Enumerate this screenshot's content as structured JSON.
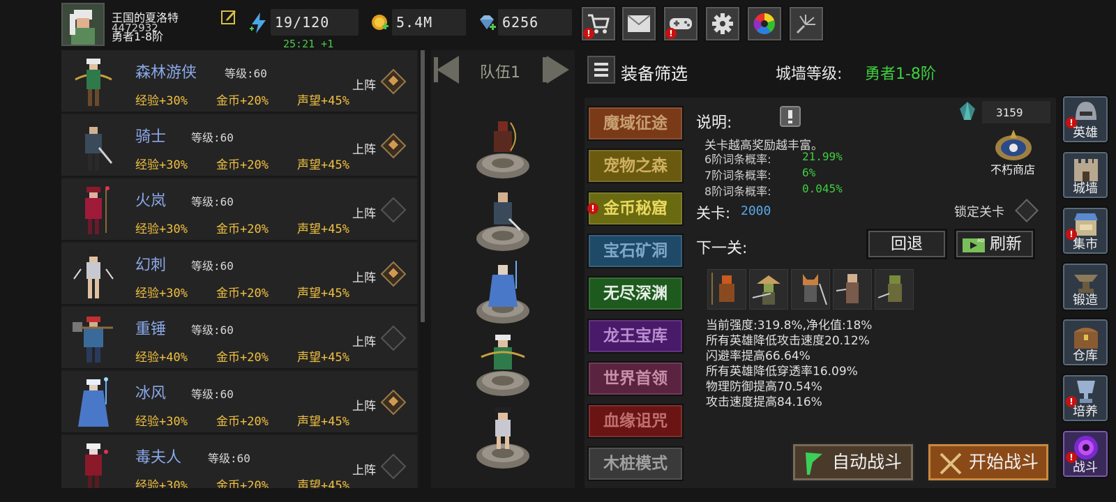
{
  "player": {
    "name": "王国的夏洛特",
    "id": "4472932",
    "rank": "勇者1-8阶"
  },
  "resources": {
    "energy": "19/120",
    "energy_timer": "25:21 +1",
    "gold": "5.4M",
    "gems": "6256"
  },
  "top_buttons": [
    "shop-cart-icon",
    "mail-icon",
    "gamepad-icon",
    "settings-gear-icon",
    "color-wheel-icon",
    "fireworks-icon"
  ],
  "heroes": [
    {
      "name": "森林游侠",
      "level": "等级:60",
      "exp": "经验+30%",
      "gold": "金币+20%",
      "fame": "声望+45%",
      "deploy": "上阵",
      "deployed": true
    },
    {
      "name": "骑士",
      "level": "等级:60",
      "exp": "经验+30%",
      "gold": "金币+20%",
      "fame": "声望+45%",
      "deploy": "上阵",
      "deployed": true
    },
    {
      "name": "火岚",
      "level": "等级:60",
      "exp": "经验+30%",
      "gold": "金币+20%",
      "fame": "声望+45%",
      "deploy": "上阵",
      "deployed": false
    },
    {
      "name": "幻刺",
      "level": "等级:60",
      "exp": "经验+30%",
      "gold": "金币+20%",
      "fame": "声望+45%",
      "deploy": "上阵",
      "deployed": true
    },
    {
      "name": "重锤",
      "level": "等级:60",
      "exp": "经验+40%",
      "gold": "金币+20%",
      "fame": "声望+45%",
      "deploy": "上阵",
      "deployed": false
    },
    {
      "name": "冰风",
      "level": "等级:60",
      "exp": "经验+30%",
      "gold": "金币+20%",
      "fame": "声望+45%",
      "deploy": "上阵",
      "deployed": true
    },
    {
      "name": "毒夫人",
      "level": "等级:60",
      "exp": "经验+30%",
      "gold": "金币+20%",
      "fame": "声望+45%",
      "deploy": "上阵",
      "deployed": false
    }
  ],
  "team": {
    "label": "队伍1"
  },
  "filter": {
    "label": "装备筛选"
  },
  "wall": {
    "label": "城墙等级:",
    "value": "勇者1-8阶"
  },
  "modes": [
    {
      "label": "魔域征途",
      "color": "#7a3a18",
      "text": "#c8a070"
    },
    {
      "label": "宠物之森",
      "color": "#6a5a10",
      "text": "#d0b060"
    },
    {
      "label": "金币秘窟",
      "color": "#6a6a10",
      "text": "#e8d860"
    },
    {
      "label": "宝石矿洞",
      "color": "#1e4a68",
      "text": "#80a8c8"
    },
    {
      "label": "无尽深渊",
      "color": "#1e5a1e",
      "text": "#e8f0e8"
    },
    {
      "label": "龙王宝库",
      "color": "#4a1a6a",
      "text": "#b890d0"
    },
    {
      "label": "世界首领",
      "color": "#5a2440",
      "text": "#c890a8"
    },
    {
      "label": "血缘诅咒",
      "color": "#6a1414",
      "text": "#c07070"
    },
    {
      "label": "木桩模式",
      "color": "#3a3a3a",
      "text": "#a0a0a0"
    }
  ],
  "description": {
    "title": "说明:",
    "line": "关卡越高奖励越丰富。",
    "probs": [
      {
        "label": "6阶词条概率:",
        "value": "21.99%"
      },
      {
        "label": "7阶词条概率:",
        "value": "6%"
      },
      {
        "label": "8阶词条概率:",
        "value": "0.045%"
      }
    ]
  },
  "currency_box": {
    "value": "3159"
  },
  "immortal_shop": {
    "label": "不朽商店"
  },
  "stage": {
    "label": "关卡:",
    "value": "2000"
  },
  "lock_stage": {
    "label": "锁定关卡"
  },
  "next_stage": {
    "label": "下一关:"
  },
  "actions": {
    "back": "回退",
    "refresh": "刷新",
    "ad_badge": "AD"
  },
  "effects": [
    "当前强度:319.8%,净化值:18%",
    "所有英雄降低攻击速度20.12%",
    "闪避率提高66.64%",
    "所有英雄降低穿透率16.09%",
    "物理防御提高70.54%",
    "攻击速度提高84.16%"
  ],
  "battle": {
    "auto": "自动战斗",
    "start": "开始战斗"
  },
  "sidebar": [
    {
      "label": "英雄",
      "icon": "helmet-icon",
      "warn": true
    },
    {
      "label": "城墙",
      "icon": "castle-wall-icon",
      "warn": false
    },
    {
      "label": "集市",
      "icon": "market-stall-icon",
      "warn": true
    },
    {
      "label": "锻造",
      "icon": "anvil-icon",
      "warn": false
    },
    {
      "label": "仓库",
      "icon": "treasure-chest-icon",
      "warn": false
    },
    {
      "label": "培养",
      "icon": "trophy-cup-icon",
      "warn": true
    },
    {
      "label": "战斗",
      "icon": "portal-icon",
      "warn": true
    }
  ]
}
